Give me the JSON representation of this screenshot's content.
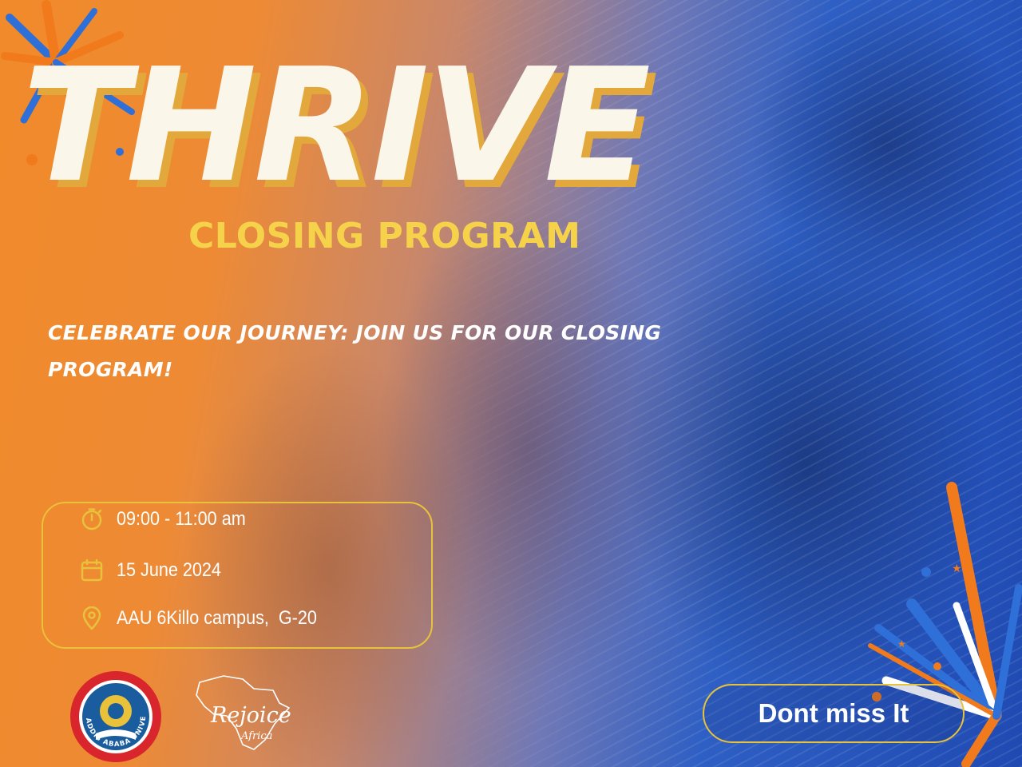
{
  "event": {
    "title": "THRIVE",
    "subtitle": "CLOSING PROGRAM",
    "tagline": "CELEBRATE OUR JOURNEY: JOIN US FOR OUR CLOSING PROGRAM!"
  },
  "details": {
    "time": "09:00 - 11:00 am",
    "date": "15 June 2024",
    "location": "AAU 6Killo campus,  G-20"
  },
  "partners": {
    "university_logo_text": "ADDIS ABABA UNIVERSITY",
    "rejoice_name": "Rejoice",
    "rejoice_sub": "Africa"
  },
  "cta": {
    "label": "Dont miss It"
  },
  "colors": {
    "orange": "#f08a2a",
    "blue": "#1f4ab2",
    "gold": "#e8c23a",
    "title_yellow": "#f6d24a",
    "cream": "#fbf6ea"
  },
  "icons": {
    "time": "stopwatch-icon",
    "date": "calendar-icon",
    "location": "map-pin-icon"
  }
}
